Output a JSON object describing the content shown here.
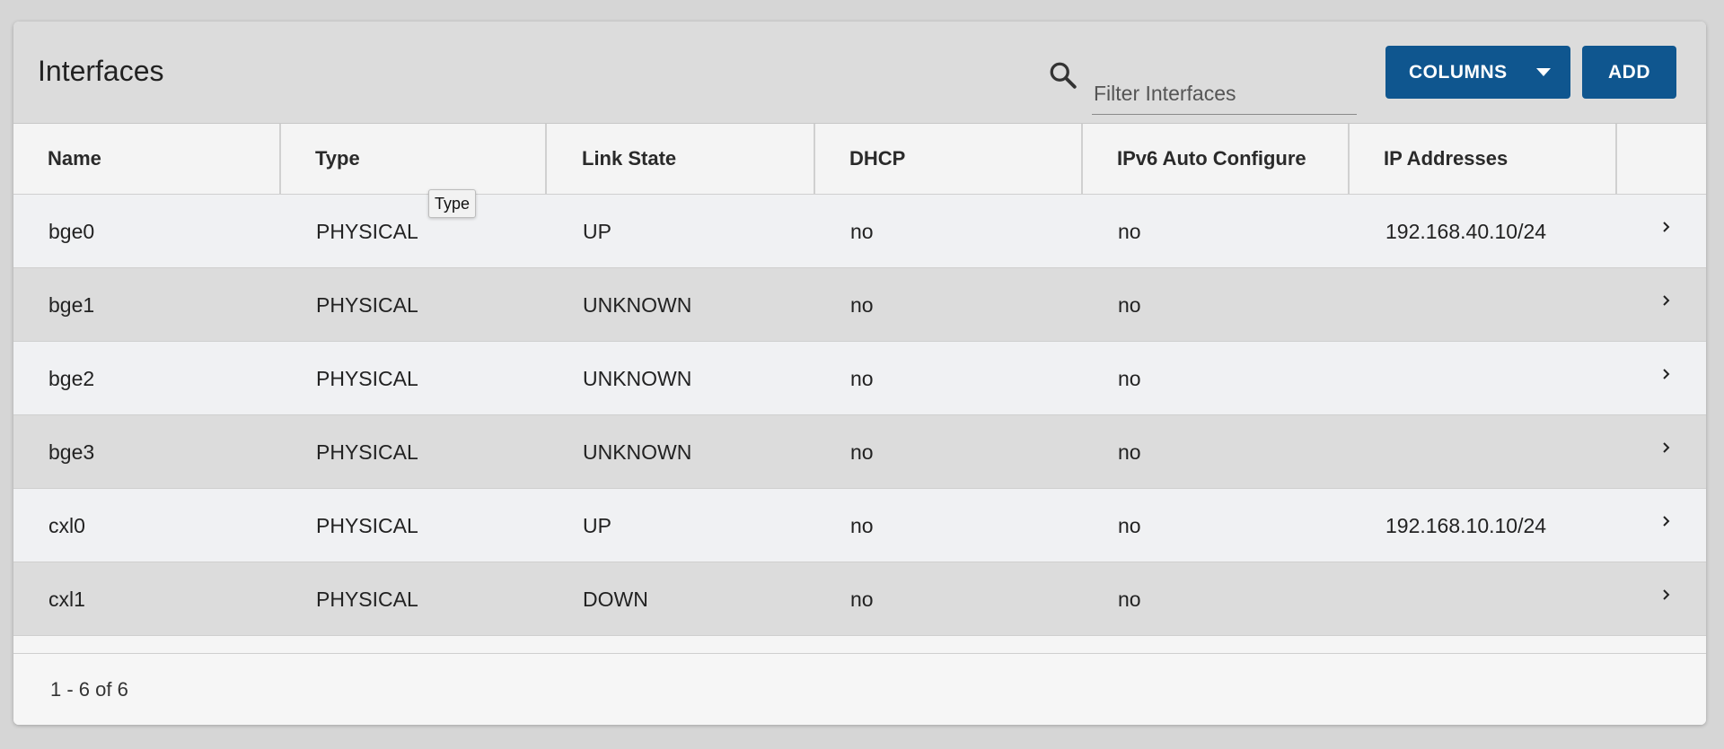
{
  "header": {
    "title": "Interfaces",
    "search_placeholder": "Filter Interfaces",
    "columns_label": "COLUMNS",
    "add_label": "ADD"
  },
  "table": {
    "columns": [
      "Name",
      "Type",
      "Link State",
      "DHCP",
      "IPv6 Auto Configure",
      "IP Addresses"
    ],
    "rows": [
      [
        "bge0",
        "PHYSICAL",
        "UP",
        "no",
        "no",
        "192.168.40.10/24"
      ],
      [
        "bge1",
        "PHYSICAL",
        "UNKNOWN",
        "no",
        "no",
        ""
      ],
      [
        "bge2",
        "PHYSICAL",
        "UNKNOWN",
        "no",
        "no",
        ""
      ],
      [
        "bge3",
        "PHYSICAL",
        "UNKNOWN",
        "no",
        "no",
        ""
      ],
      [
        "cxl0",
        "PHYSICAL",
        "UP",
        "no",
        "no",
        "192.168.10.10/24"
      ],
      [
        "cxl1",
        "PHYSICAL",
        "DOWN",
        "no",
        "no",
        ""
      ]
    ]
  },
  "tooltip": "Type",
  "footer": {
    "pagination": "1 - 6 of 6"
  },
  "icons": {
    "search": "search-icon",
    "dropdown": "caret-down-icon",
    "row_action": "chevron-right-icon"
  },
  "colors": {
    "accent": "#0f568f",
    "header_bg": "#dcdcdc",
    "row_odd": "#f0f1f3",
    "row_even": "#dcdcdc"
  }
}
